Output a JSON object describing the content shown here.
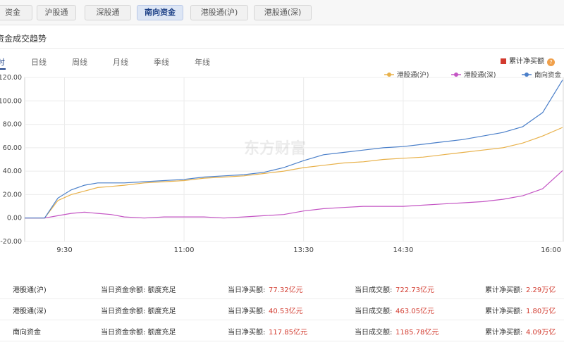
{
  "top_tabs": [
    {
      "label": "资金",
      "active": false
    },
    {
      "label": "沪股通",
      "active": false
    },
    {
      "label": "深股通",
      "active": false
    },
    {
      "label": "南向资金",
      "active": true
    },
    {
      "label": "港股通(沪)",
      "active": false
    },
    {
      "label": "港股通(深)",
      "active": false
    }
  ],
  "section_title": "资金成交趋势",
  "period_tabs": [
    {
      "label": "时",
      "active": true
    },
    {
      "label": "日线",
      "active": false
    },
    {
      "label": "周线",
      "active": false
    },
    {
      "label": "月线",
      "active": false
    },
    {
      "label": "季线",
      "active": false
    },
    {
      "label": "年线",
      "active": false
    }
  ],
  "cumulative_legend": {
    "label": "累计净买额",
    "help_icon": "question-icon",
    "color": "#d23a2e"
  },
  "watermark": "东方财富",
  "chart_data": {
    "type": "line",
    "x_ticks": [
      "9:30",
      "11:00",
      "13:30",
      "14:30",
      "16:00"
    ],
    "y_ticks": [
      "120.00",
      "100.00",
      "80.00",
      "60.00",
      "40.00",
      "20.00",
      "0.00",
      "-20.00"
    ],
    "ylim": [
      -20,
      120
    ],
    "grid": true,
    "legend_position": "top-right",
    "x": [
      0,
      15,
      25,
      35,
      45,
      55,
      65,
      75,
      90,
      105,
      120,
      135,
      150,
      165,
      180,
      195,
      210,
      225,
      240,
      255,
      270,
      285,
      300,
      315,
      330,
      345,
      360,
      375,
      390,
      405
    ],
    "series": [
      {
        "name": "港股通(沪)",
        "color": "#e8b14a",
        "values": [
          0,
          0,
          15,
          20,
          23,
          26,
          27,
          28,
          30,
          31,
          32,
          34,
          35,
          36,
          38,
          40,
          43,
          45,
          47,
          48,
          50,
          51,
          52,
          54,
          56,
          58,
          60,
          64,
          70,
          77.32
        ]
      },
      {
        "name": "港股通(深)",
        "color": "#c455c4",
        "values": [
          0,
          0,
          2,
          4,
          5,
          4,
          3,
          1,
          0,
          1,
          1,
          1,
          0,
          1,
          2,
          3,
          6,
          8,
          9,
          10,
          10,
          10,
          11,
          12,
          13,
          14,
          16,
          19,
          25,
          40.53
        ]
      },
      {
        "name": "南向资金",
        "color": "#4a7fc9",
        "values": [
          0,
          0,
          17,
          24,
          28,
          30,
          30,
          30,
          31,
          32,
          33,
          35,
          36,
          37,
          39,
          43,
          49,
          54,
          56,
          58,
          60,
          61,
          63,
          65,
          67,
          70,
          73,
          78,
          90,
          117.85
        ]
      }
    ]
  },
  "summary_rows": [
    {
      "name": "港股通(沪)",
      "balance": "当日资金余额: 额度充足",
      "net_label": "当日净买额:",
      "net_value": "77.32亿元",
      "turnover_label": "当日成交额:",
      "turnover_value": "722.73亿元",
      "cum_label": "累计净买额:",
      "cum_value": "2.29万亿"
    },
    {
      "name": "港股通(深)",
      "balance": "当日资金余额: 额度充足",
      "net_label": "当日净买额:",
      "net_value": "40.53亿元",
      "turnover_label": "当日成交额:",
      "turnover_value": "463.05亿元",
      "cum_label": "累计净买额:",
      "cum_value": "1.80万亿"
    },
    {
      "name": "南向资金",
      "balance": "当日资金余额: 额度充足",
      "net_label": "当日净买额:",
      "net_value": "117.85亿元",
      "turnover_label": "当日成交额:",
      "turnover_value": "1185.78亿元",
      "cum_label": "累计净买额:",
      "cum_value": "4.09万亿"
    }
  ]
}
